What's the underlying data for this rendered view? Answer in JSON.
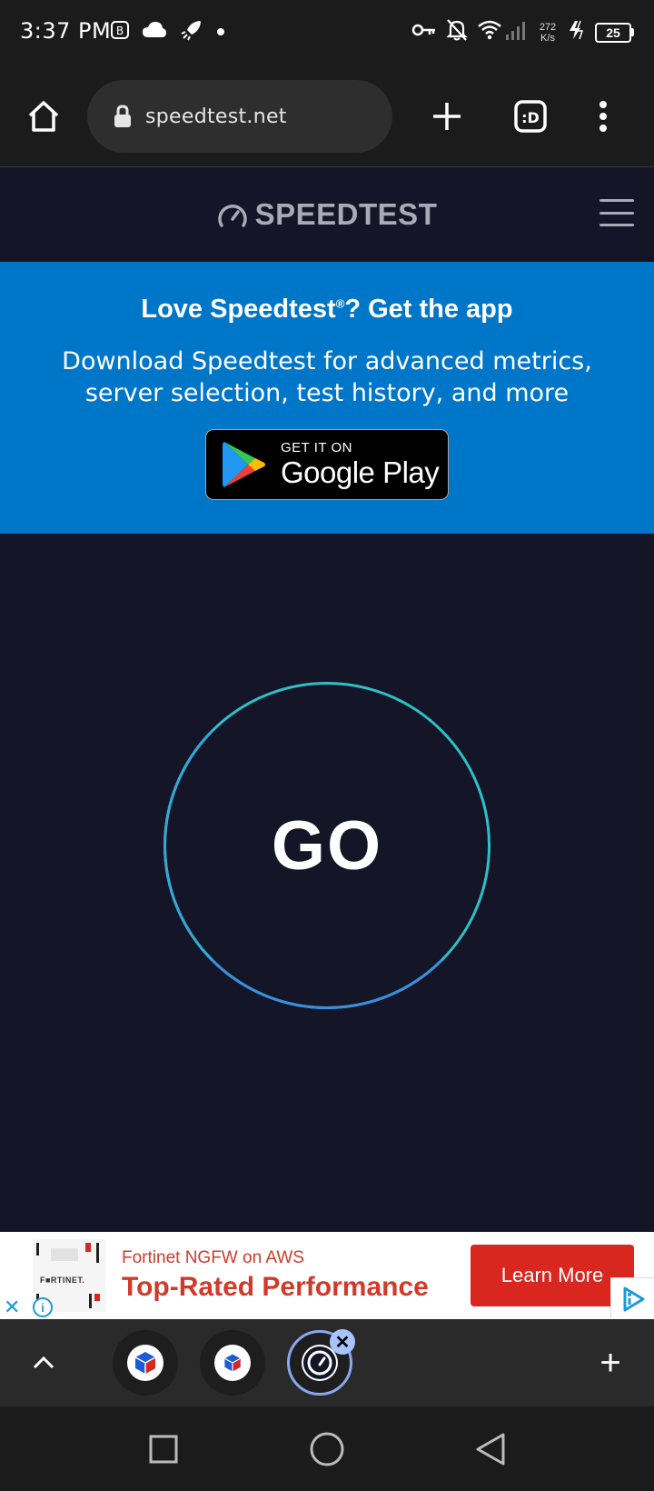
{
  "status_bar": {
    "time": "3:37 PM",
    "net_speed_value": "272",
    "net_speed_unit": "K/s",
    "battery": "25"
  },
  "browser": {
    "url": "speedtest.net",
    "icons": [
      "home-icon",
      "lock-icon",
      "new-tab-icon",
      "tab-switcher-icon",
      "more-vert-icon"
    ]
  },
  "site": {
    "logo_text": "SPEEDTEST",
    "promo": {
      "title": "Love Speedtest",
      "title_reg": "®",
      "title_suffix": "? Get the app",
      "description": "Download Speedtest for advanced metrics, server selection, test history, and more",
      "badge_small": "GET IT ON",
      "badge_big": "Google Play"
    },
    "go_label": "GO"
  },
  "ad": {
    "brand": "F■RTINET.",
    "line1": "Fortinet NGFW on AWS",
    "line2": "Top-Rated Performance",
    "cta": "Learn More",
    "close": "✕",
    "info": "i"
  },
  "tab_strip": {
    "add": "+",
    "close": "✕"
  },
  "colors": {
    "promo_bg": "#0076c8",
    "page_bg": "#141526",
    "ring": "#2ec0c6",
    "ad_accent": "#d9261e"
  }
}
